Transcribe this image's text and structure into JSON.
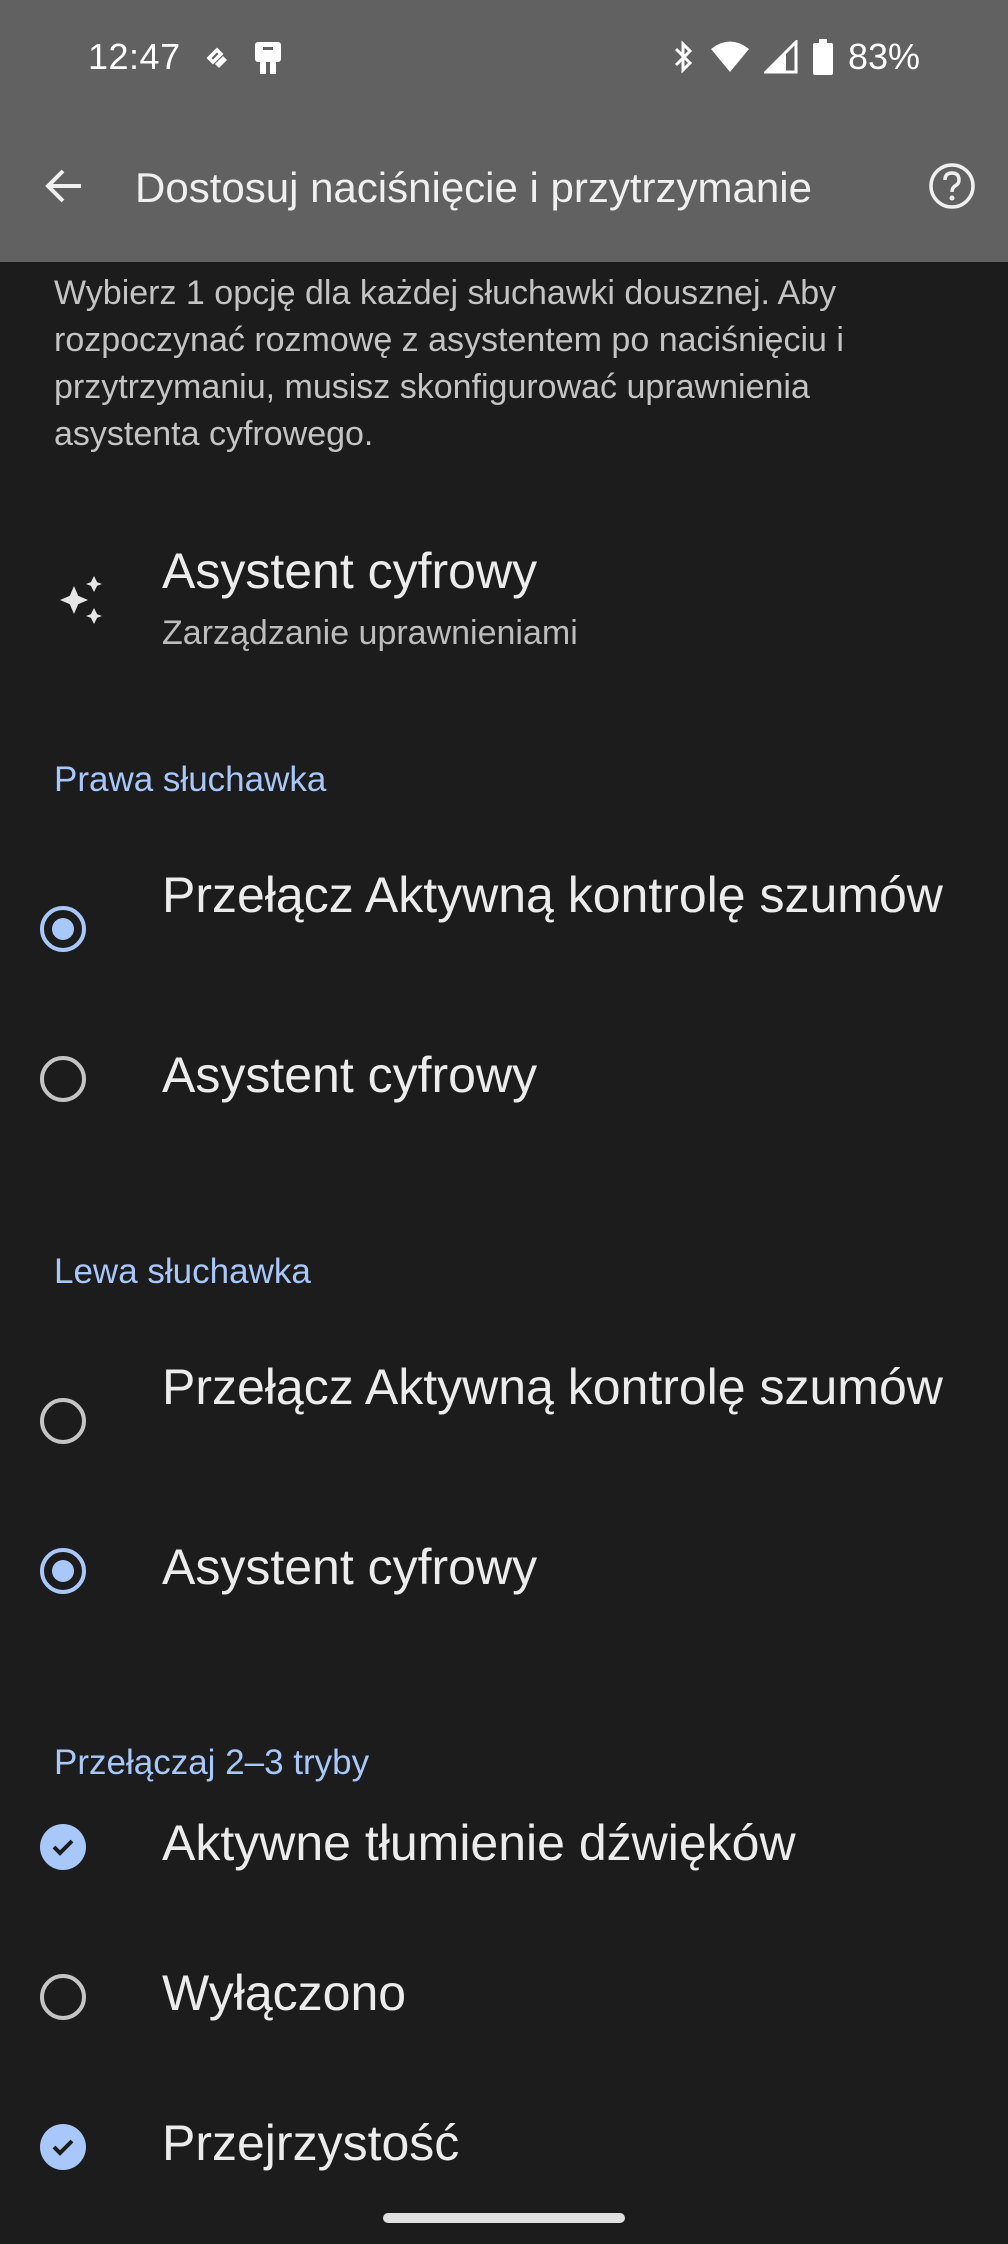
{
  "status_bar": {
    "time": "12:47",
    "left_icons": [
      "notification-icon",
      "device-icon"
    ],
    "right_icons": [
      "bluetooth-icon",
      "wifi-icon",
      "signal-icon",
      "battery-icon"
    ],
    "battery_text": "83%"
  },
  "app_bar": {
    "title": "Dostosuj naciśnięcie i przytrzymanie",
    "back_icon": "arrow-back-icon",
    "help_icon": "help-circle-icon"
  },
  "intro_text": "Wybierz 1 opcję dla każdej słuchawki dousznej. Aby rozpoczynać rozmowę z asystentem po naciśnięciu i przytrzymaniu, musisz skonfigurować uprawnienia asystenta cyfrowego.",
  "assistant_item": {
    "title": "Asystent cyfrowy",
    "subtitle": "Zarządzanie uprawnieniami",
    "icon": "sparkle-icon"
  },
  "sections": {
    "right": {
      "header": "Prawa słuchawka",
      "options": [
        {
          "label": "Przełącz Aktywną kontrolę szumów",
          "selected": true
        },
        {
          "label": "Asystent cyfrowy",
          "selected": false
        }
      ]
    },
    "left": {
      "header": "Lewa słuchawka",
      "options": [
        {
          "label": "Przełącz Aktywną kontrolę szumów",
          "selected": false
        },
        {
          "label": "Asystent cyfrowy",
          "selected": true
        }
      ]
    },
    "modes": {
      "header": "Przełączaj 2–3 tryby",
      "options": [
        {
          "label": "Aktywne tłumienie dźwięków",
          "checked": true
        },
        {
          "label": "Wyłączono",
          "checked": false
        },
        {
          "label": "Przejrzystość",
          "checked": true
        }
      ]
    }
  },
  "colors": {
    "accent": "#a8c7fa",
    "background": "#1c1c1c",
    "top_bar": "#616161"
  }
}
